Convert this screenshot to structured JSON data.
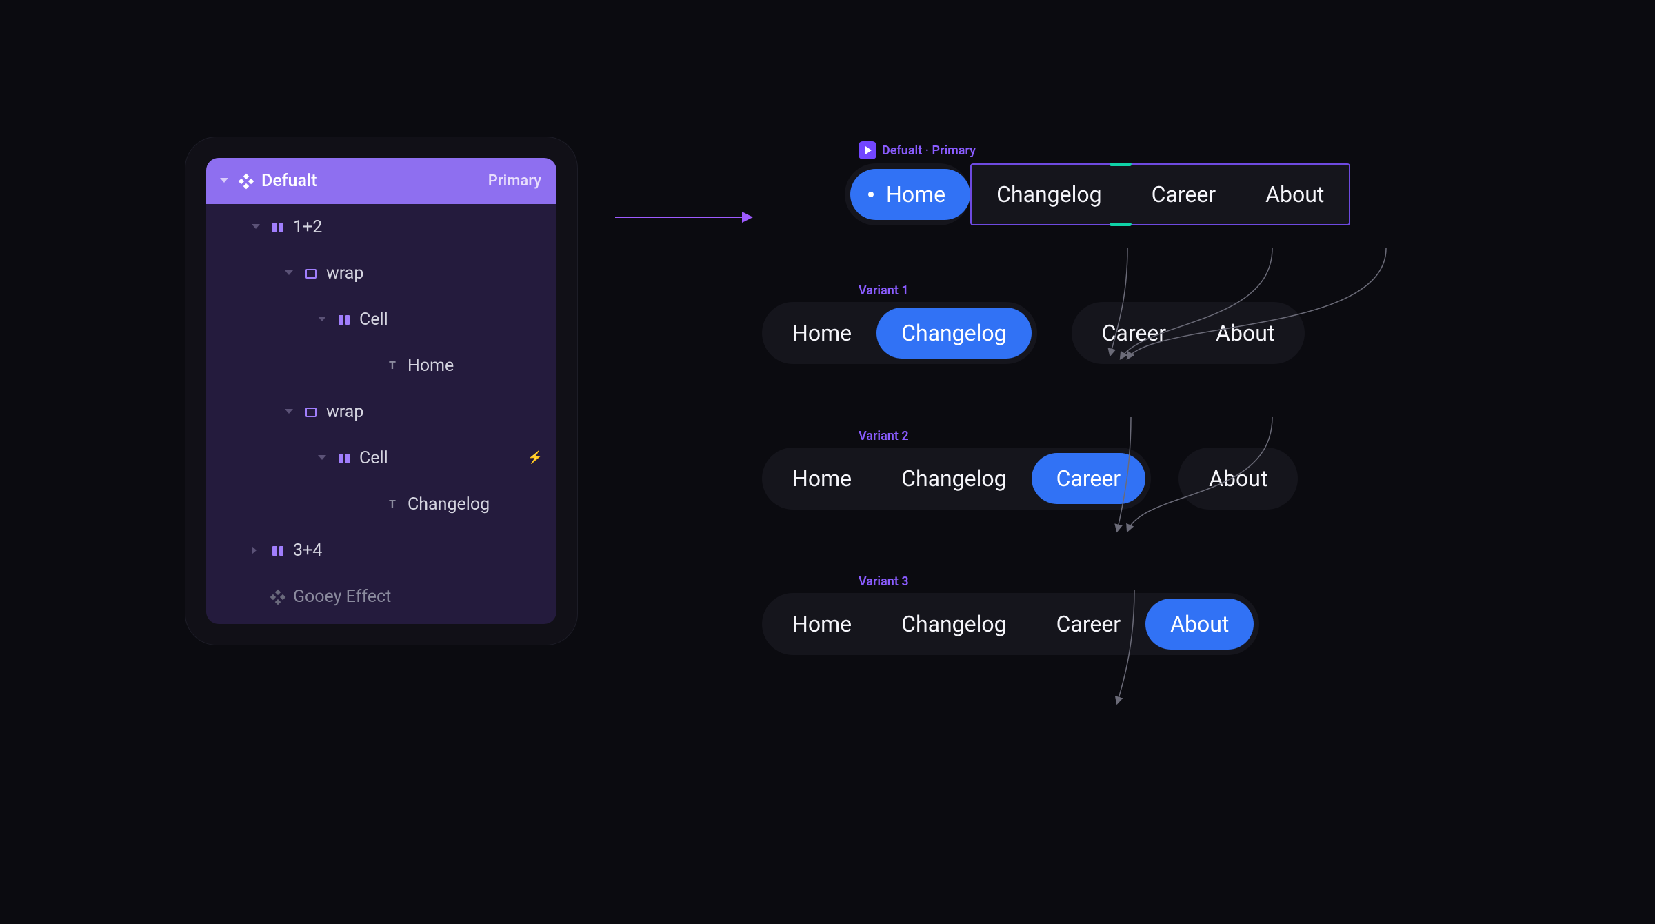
{
  "panel": {
    "header": {
      "title": "Defualt",
      "badge": "Primary"
    },
    "items": [
      {
        "indent": 1,
        "caret": "down",
        "icon": "hbox",
        "label": "1+2"
      },
      {
        "indent": 2,
        "caret": "down",
        "icon": "frame",
        "label": "wrap"
      },
      {
        "indent": 3,
        "caret": "down",
        "icon": "hbox",
        "label": "Cell"
      },
      {
        "indent": 4,
        "caret": "",
        "icon": "text",
        "label": "Home"
      },
      {
        "indent": 2,
        "caret": "down",
        "icon": "frame",
        "label": "wrap"
      },
      {
        "indent": 3,
        "caret": "down",
        "icon": "hbox",
        "label": "Cell",
        "bolt": true
      },
      {
        "indent": 4,
        "caret": "",
        "icon": "text",
        "label": "Changelog"
      },
      {
        "indent": 1,
        "caret": "right",
        "icon": "hbox",
        "label": "3+4"
      },
      {
        "indent": 1,
        "caret": "",
        "icon": "component-dim",
        "label": "Gooey Effect",
        "dim": true
      }
    ]
  },
  "canvas": {
    "main_label": "Defualt · Primary",
    "variants": [
      {
        "label": "",
        "active_index": 0
      },
      {
        "label": "Variant 1",
        "active_index": 1
      },
      {
        "label": "Variant 2",
        "active_index": 2
      },
      {
        "label": "Variant 3",
        "active_index": 3
      }
    ],
    "tabs": [
      "Home",
      "Changelog",
      "Career",
      "About"
    ]
  }
}
